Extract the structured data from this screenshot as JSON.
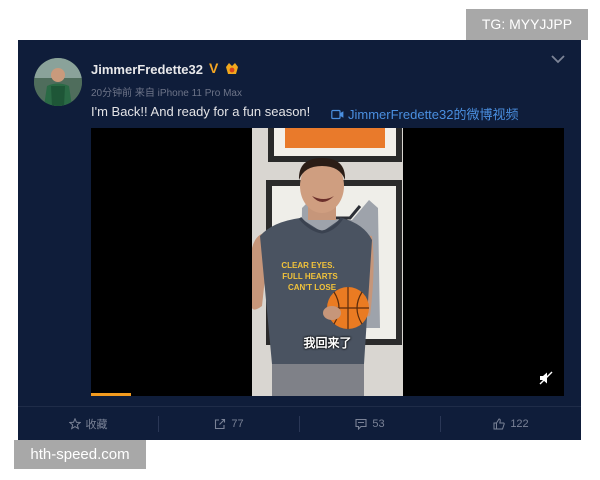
{
  "watermarks": {
    "top_right": "TG: MYYJJPP",
    "bottom_left": "hth-speed.com"
  },
  "post": {
    "username": "JimmerFredette32",
    "verified_badge": "V",
    "meta": "20分钟前 来自 iPhone 11 Pro Max",
    "text": "I'm Back!!  And ready for a fun season!",
    "video_link": "JimmerFredette32的微博视频"
  },
  "video": {
    "subtitle": "我回来了",
    "shirt_lines": [
      "CLEAR EYES.",
      "FULL HEARTS",
      "CAN'T LOSE"
    ],
    "progress_fraction": 0.085
  },
  "actions": {
    "favorite": "收藏",
    "repost": "77",
    "comment": "53",
    "like": "122"
  },
  "colors": {
    "card_bg": "#0f1d3a",
    "link": "#4a8fe0",
    "progress": "#f39b1f",
    "badge": "#f5a623"
  },
  "icons": [
    "chevron-down-icon",
    "medal-icon",
    "video-link-icon",
    "mute-icon",
    "star-icon",
    "repost-icon",
    "comment-icon",
    "like-icon"
  ]
}
